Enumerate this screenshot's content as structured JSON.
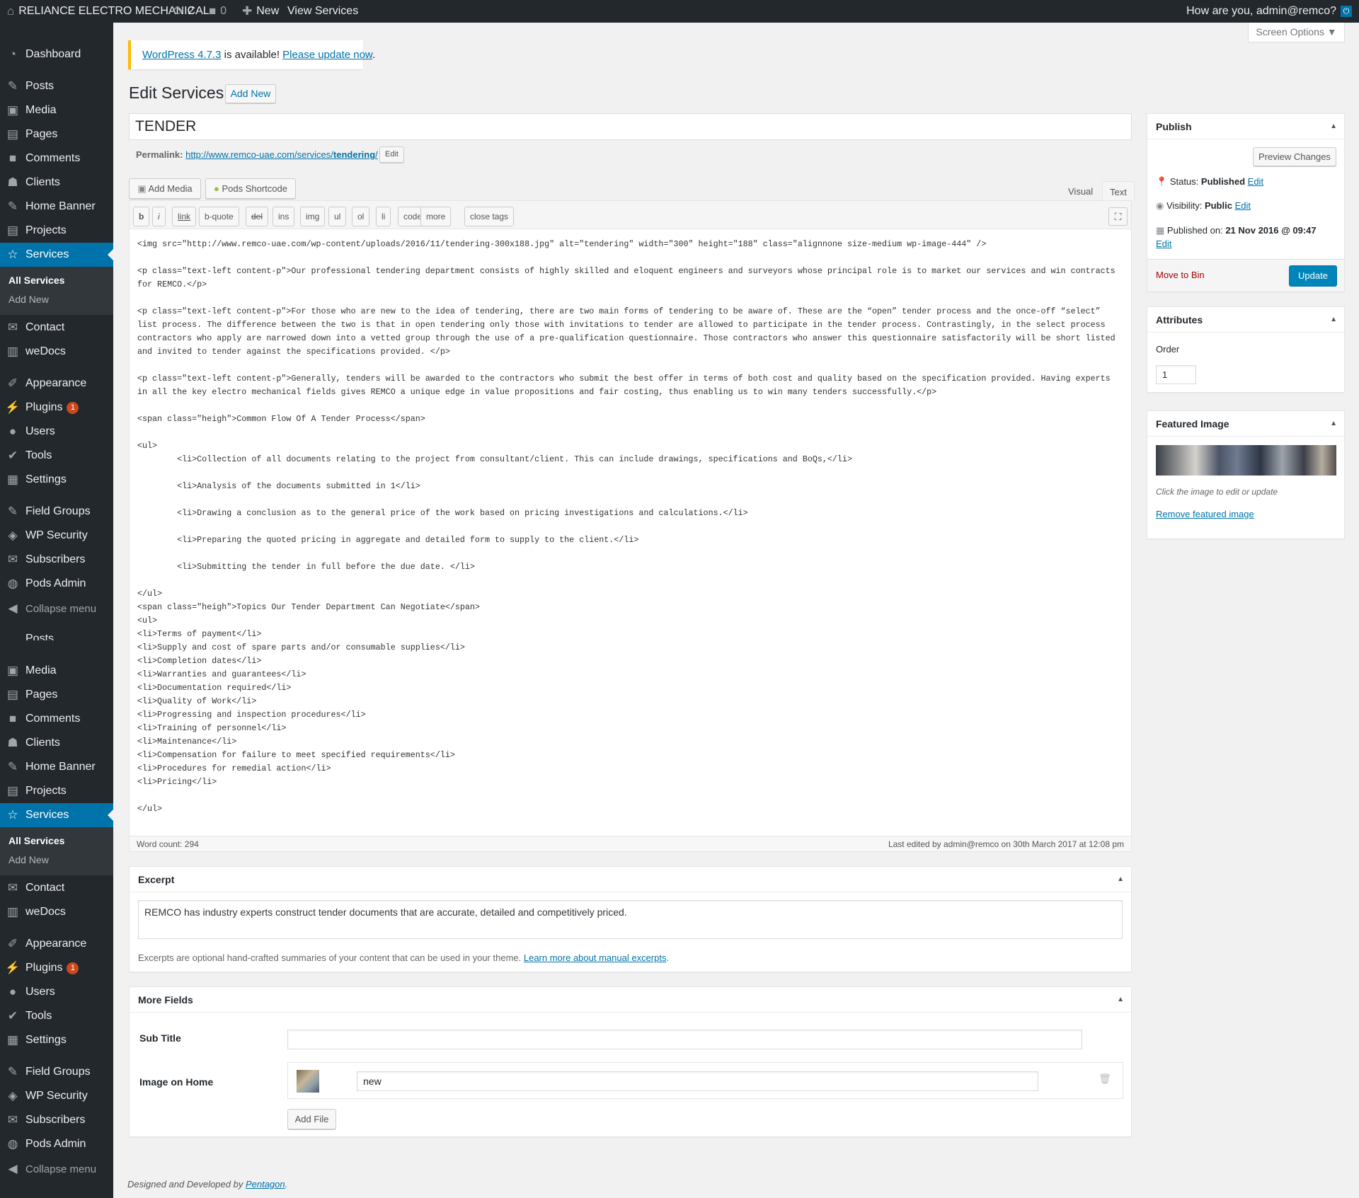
{
  "adminbar": {
    "site_name": "RELIANCE ELECTRO MECHANICAL",
    "updates_count": "2",
    "comments_count": "0",
    "new_label": "New",
    "view_label": "View Services",
    "greeting": "How are you, admin@remco?"
  },
  "sidebar": {
    "items": [
      {
        "label": "Dashboard",
        "icon": "dashboard-icon"
      },
      {
        "label": "Posts",
        "icon": "pin-icon"
      },
      {
        "label": "Media",
        "icon": "media-icon"
      },
      {
        "label": "Pages",
        "icon": "pages-icon"
      },
      {
        "label": "Comments",
        "icon": "comments-icon"
      },
      {
        "label": "Clients",
        "icon": "groups-icon"
      },
      {
        "label": "Home Banner",
        "icon": "pin-icon"
      },
      {
        "label": "Projects",
        "icon": "pages-icon"
      },
      {
        "label": "Services",
        "icon": "star-icon"
      },
      {
        "label": "Contact",
        "icon": "mail-icon"
      },
      {
        "label": "weDocs",
        "icon": "document-icon"
      },
      {
        "label": "Appearance",
        "icon": "brush-icon"
      },
      {
        "label": "Plugins",
        "icon": "plug-icon",
        "badge": "1"
      },
      {
        "label": "Users",
        "icon": "user-icon"
      },
      {
        "label": "Tools",
        "icon": "wrench-icon"
      },
      {
        "label": "Settings",
        "icon": "settings-icon"
      },
      {
        "label": "Field Groups",
        "icon": "pin-icon"
      },
      {
        "label": "WP Security",
        "icon": "shield-icon"
      },
      {
        "label": "Subscribers",
        "icon": "mail-icon"
      },
      {
        "label": "Pods Admin",
        "icon": "pods-icon"
      },
      {
        "label": "Collapse menu",
        "icon": "collapse-icon"
      }
    ],
    "submenu": [
      "All Services",
      "Add New"
    ],
    "partial_label": "Posts"
  },
  "notice": {
    "link1": "WordPress 4.7.3",
    "text": " is available! ",
    "link2": "Please update now",
    "end": "."
  },
  "screen_options": "Screen Options ▼",
  "page_title": "Edit Services",
  "add_new": "Add New",
  "post_title": "TENDER",
  "permalink": {
    "label": "Permalink:",
    "url_base": "http://www.remco-uae.com/services/",
    "slug": "tendering",
    "url_end": "/",
    "edit": "Edit"
  },
  "media_buttons": {
    "add_media": "Add Media",
    "pods": "Pods Shortcode"
  },
  "editor_tabs": {
    "visual": "Visual",
    "text": "Text"
  },
  "quicktags": [
    "b",
    "i",
    "link",
    "b-quote",
    "del",
    "ins",
    "img",
    "ul",
    "ol",
    "li",
    "code",
    "more",
    "close tags"
  ],
  "content": "<img src=\"http://www.remco-uae.com/wp-content/uploads/2016/11/tendering-300x188.jpg\" alt=\"tendering\" width=\"300\" height=\"188\" class=\"alignnone size-medium wp-image-444\" />\n\n<p class=\"text-left content-p\">Our professional tendering department consists of highly skilled and eloquent engineers and surveyors whose principal role is to market our services and win contracts for REMCO.</p>\n\n<p class=\"text-left content-p\">For those who are new to the idea of tendering, there are two main forms of tendering to be aware of. These are the “open” tender process and the once-off “select” list process. The difference between the two is that in open tendering only those with invitations to tender are allowed to participate in the tender process. Contrastingly, in the select process contractors who apply are narrowed down into a vetted group through the use of a pre-qualification questionnaire. Those contractors who answer this questionnaire satisfactorily will be short listed and invited to tender against the specifications provided. </p>\n\n<p class=\"text-left content-p\">Generally, tenders will be awarded to the contractors who submit the best offer in terms of both cost and quality based on the specification provided. Having experts in all the key electro mechanical fields gives REMCO a unique edge in value propositions and fair costing, thus enabling us to win many tenders successfully.</p>\n\n<span class=\"heigh\">Common Flow Of A Tender Process</span>\n\n<ul>\n\t<li>Collection of all documents relating to the project from consultant/client. This can include drawings, specifications and BoQs,</li>\n\n\t<li>Analysis of the documents submitted in 1</li>\n\n\t<li>Drawing a conclusion as to the general price of the work based on pricing investigations and calculations.</li>\n\n\t<li>Preparing the quoted pricing in aggregate and detailed form to supply to the client.</li>\n\n\t<li>Submitting the tender in full before the due date. </li>\n\n</ul>\n<span class=\"heigh\">Topics Our Tender Department Can Negotiate</span>\n<ul>\n<li>Terms of payment</li>\n<li>Supply and cost of spare parts and/or consumable supplies</li>\n<li>Completion dates</li>\n<li>Warranties and guarantees</li>\n<li>Documentation required</li>\n<li>Quality of Work</li>\n<li>Progressing and inspection procedures</li>\n<li>Training of personnel</li>\n<li>Maintenance</li>\n<li>Compensation for failure to meet specified requirements</li>\n<li>Procedures for remedial action</li>\n<li>Pricing</li>\n\n</ul>",
  "word_count": "Word count: 294",
  "last_edited": "Last edited by admin@remco on 30th March 2017 at 12:08 pm",
  "excerpt": {
    "title": "Excerpt",
    "value": "REMCO has industry experts construct tender documents that are accurate, detailed and competitively priced.",
    "help": "Excerpts are optional hand-crafted summaries of your content that can be used in your theme. ",
    "help_link": "Learn more about manual excerpts",
    "help_end": "."
  },
  "more_fields": {
    "title": "More Fields",
    "sub_title_label": "Sub Title",
    "sub_title_value": "",
    "image_label": "Image on Home",
    "image_name": "new",
    "add_file": "Add File"
  },
  "publish": {
    "title": "Publish",
    "preview": "Preview Changes",
    "status_label": "Status:",
    "status_value": "Published",
    "visibility_label": "Visibility:",
    "visibility_value": "Public",
    "published_label": "Published on:",
    "published_value": "21 Nov 2016 @ 09:47",
    "edit": "Edit",
    "move_to_bin": "Move to Bin",
    "update": "Update"
  },
  "attributes": {
    "title": "Attributes",
    "order_label": "Order",
    "order_value": "1"
  },
  "featured": {
    "title": "Featured Image",
    "hint": "Click the image to edit or update",
    "remove": "Remove featured image"
  },
  "footer": {
    "text": "Designed and Developed by ",
    "link": "Pentagon",
    "end": "."
  },
  "colors": {
    "accent": "#0073aa",
    "admin_bar": "#23282d",
    "notice": "#ffb900",
    "badge": "#ca4a1f",
    "danger": "#a00"
  }
}
